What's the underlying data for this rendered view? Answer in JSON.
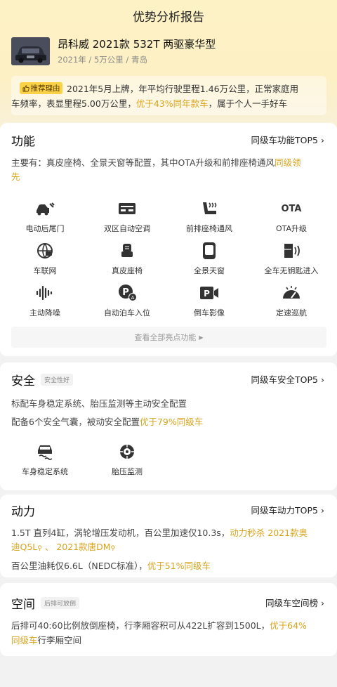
{
  "page": {
    "title": "优势分析报告"
  },
  "car": {
    "name": "昂科威 2021款 532T 两驱豪华型",
    "meta": "2021年 / 5万公里 / 青岛"
  },
  "reason": {
    "tag": "推荐理由",
    "line1": "2021年5月上牌，年平均行驶里程1.46万公里，正常家庭用",
    "line2_a": "车频率，表显里程5.00万公里，",
    "line2_hl": "优于43%同年款车",
    "line2_b": "，属于个人一手好车"
  },
  "features": {
    "title": "功能",
    "link": "同级车功能TOP5",
    "desc_line1_a": "主要有：真皮座椅、全景天窗等配置，其中OTA升级和前排座椅通风",
    "desc_line1_hl": "同级领",
    "desc_line2_hl": "先",
    "items": [
      {
        "label": "电动后尾门",
        "icon": "power-tailgate-icon"
      },
      {
        "label": "双区自动空调",
        "icon": "dual-zone-ac-icon"
      },
      {
        "label": "前排座椅通风",
        "icon": "seat-ventilation-icon"
      },
      {
        "label": "OTA升级",
        "icon": "ota-icon",
        "icon_text": "OTA"
      },
      {
        "label": "车联网",
        "icon": "connected-car-icon"
      },
      {
        "label": "真皮座椅",
        "icon": "leather-seat-icon"
      },
      {
        "label": "全景天窗",
        "icon": "panoramic-sunroof-icon"
      },
      {
        "label": "全车无钥匙进入",
        "icon": "keyless-entry-icon"
      },
      {
        "label": "主动降噪",
        "icon": "noise-cancel-icon"
      },
      {
        "label": "自动泊车入位",
        "icon": "auto-parking-icon",
        "icon_text": "P"
      },
      {
        "label": "倒车影像",
        "icon": "reverse-camera-icon",
        "icon_text": "P"
      },
      {
        "label": "定速巡航",
        "icon": "cruise-control-icon"
      }
    ],
    "more": "查看全部亮点功能"
  },
  "safety": {
    "title": "安全",
    "badge": "安全性好",
    "link": "同级车安全TOP5",
    "line1": "标配车身稳定系统、胎压监测等主动安全配置",
    "line2_a": "配备6个安全气囊，被动安全配置",
    "line2_hl": "优于79%同级车",
    "items": [
      {
        "label": "车身稳定系统",
        "icon": "stability-control-icon"
      },
      {
        "label": "胎压监测",
        "icon": "tire-pressure-icon"
      }
    ]
  },
  "power": {
    "title": "动力",
    "link": "同级车动力TOP5",
    "line1_a": "1.5T 直列4缸，涡轮增压发动机，百公里加速仅10.3s，",
    "line1_hl": "动力秒杀 2021款奥",
    "line2_hl1": "迪Q5L",
    "line2_sep": " 、 ",
    "line2_hl2": "2021款唐DM",
    "line3_a": "百公里油耗仅6.6L（NEDC标准），",
    "line3_hl": "优于51%同级车"
  },
  "space": {
    "title": "空间",
    "badge": "后排可放倒",
    "link": "同级车空间榜",
    "line1_a": "后排可40:60比例放倒座椅，行李厢容积可从422L扩容到1500L，",
    "line1_hl": "优于64%",
    "line2_hl": "同级车",
    "line2_b": "行李厢空间"
  },
  "colors": {
    "accent": "#d9a41c",
    "tag_bg": "#f9d247",
    "hero_bg": "#fdf2c6"
  }
}
